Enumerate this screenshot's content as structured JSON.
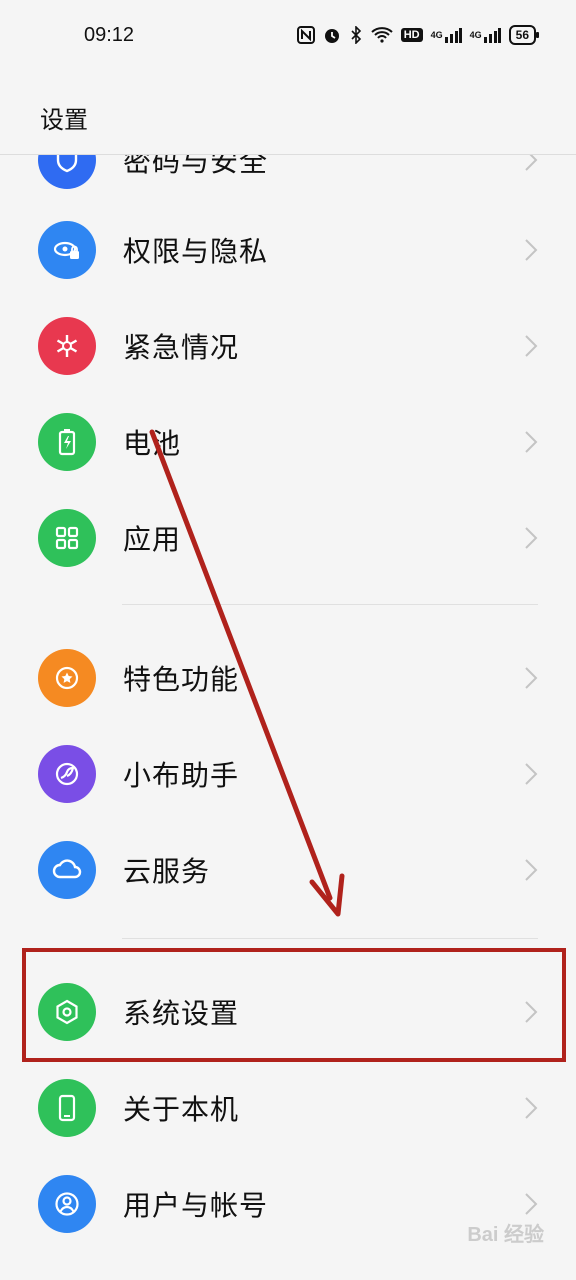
{
  "status_bar": {
    "time": "09:12",
    "icons": [
      "nfc-icon",
      "alarm-icon",
      "bluetooth-icon",
      "wifi-icon",
      "hd-icon",
      "signal-4g-icon",
      "signal-4g-icon"
    ],
    "hd_label": "HD",
    "net_label": "4G",
    "battery": "56"
  },
  "header": {
    "title": "设置"
  },
  "menu": [
    {
      "label": "密码与安全",
      "icon": "shield-icon",
      "color": "#2f6bf2"
    },
    {
      "label": "权限与隐私",
      "icon": "privacy-eye-icon",
      "color": "#2f86f2"
    },
    {
      "label": "紧急情况",
      "icon": "emergency-icon",
      "color": "#e8384f"
    },
    {
      "label": "电池",
      "icon": "battery-icon",
      "color": "#2fc15a"
    },
    {
      "label": "应用",
      "icon": "apps-grid-icon",
      "color": "#2fc15a"
    },
    {
      "label": "特色功能",
      "icon": "star-icon",
      "color": "#f58a22"
    },
    {
      "label": "小布助手",
      "icon": "assistant-icon",
      "color": "#7a4ee6"
    },
    {
      "label": "云服务",
      "icon": "cloud-icon",
      "color": "#2f86f2"
    },
    {
      "label": "系统设置",
      "icon": "system-settings-icon",
      "color": "#2fc15a"
    },
    {
      "label": "关于本机",
      "icon": "phone-icon",
      "color": "#2fc15a"
    },
    {
      "label": "用户与帐号",
      "icon": "user-icon",
      "color": "#2f86f2"
    }
  ],
  "annotation": {
    "arrow_color": "#b0221c",
    "box_color": "#b0221c"
  },
  "watermark": "Bai 经验"
}
